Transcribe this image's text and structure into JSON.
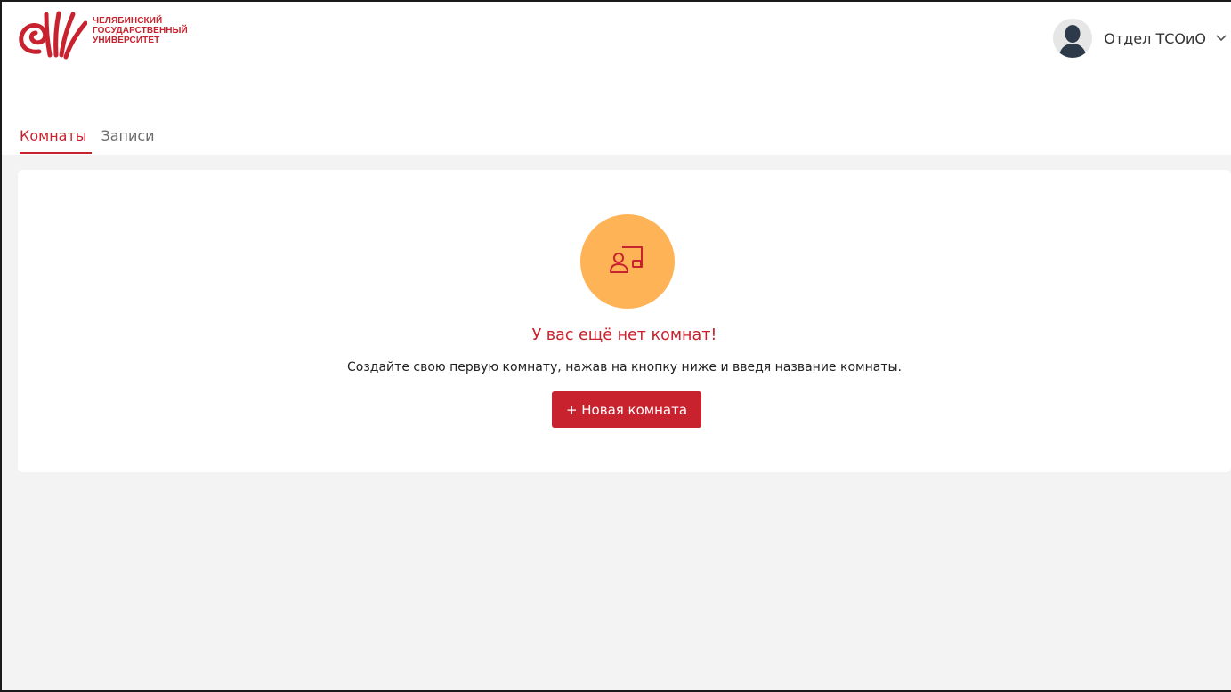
{
  "header": {
    "logo_lines": [
      "ЧЕЛЯБИНСКИЙ",
      "ГОСУДАРСТВЕННЫЙ",
      "УНИВЕРСИТЕТ"
    ],
    "user_name": "Отдел ТСОиО",
    "avatar_icon": "user-avatar-icon",
    "dropdown_icon": "chevron-down-icon"
  },
  "tabs": [
    {
      "label": "Комнаты",
      "active": true
    },
    {
      "label": "Записи",
      "active": false
    }
  ],
  "empty_state": {
    "icon": "teacher-board-icon",
    "title": "У вас ещё нет комнат!",
    "subtitle": "Создайте свою первую комнату, нажав на кнопку ниже и введя название комнаты.",
    "button_label": "+ Новая комната"
  },
  "colors": {
    "brand": "#c8222e",
    "icon_circle": "#ffb357",
    "background": "#f3f3f3"
  }
}
